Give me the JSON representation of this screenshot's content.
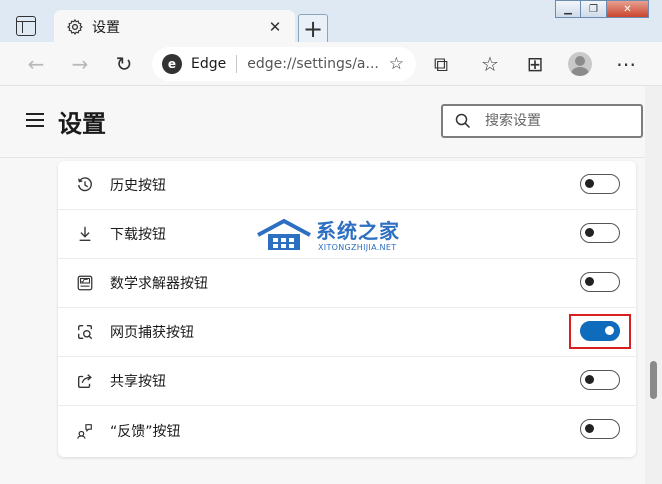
{
  "window": {
    "tab_title": "设置",
    "new_tab_symbol": "+",
    "controls": [
      "minimize",
      "restore",
      "close"
    ]
  },
  "toolbar": {
    "address_label": "Edge",
    "url": "edge://settings/a..."
  },
  "header": {
    "title": "设置",
    "search_placeholder": "搜索设置"
  },
  "settings_rows": [
    {
      "icon": "history-icon",
      "label": "历史按钮",
      "enabled": false
    },
    {
      "icon": "download-icon",
      "label": "下载按钮",
      "enabled": false
    },
    {
      "icon": "math-solver-icon",
      "label": "数学求解器按钮",
      "enabled": false
    },
    {
      "icon": "web-capture-icon",
      "label": "网页捕获按钮",
      "enabled": true,
      "highlighted": true
    },
    {
      "icon": "share-icon",
      "label": "共享按钮",
      "enabled": false
    },
    {
      "icon": "feedback-icon",
      "label": "“反馈”按钮",
      "enabled": false
    }
  ],
  "watermark": {
    "text_cn": "系统之家",
    "text_en": "XITONGZHIJIA.NET"
  },
  "colors": {
    "accent": "#0f6cbd",
    "highlight_border": "#d82020",
    "watermark": "#2d6fc1"
  }
}
